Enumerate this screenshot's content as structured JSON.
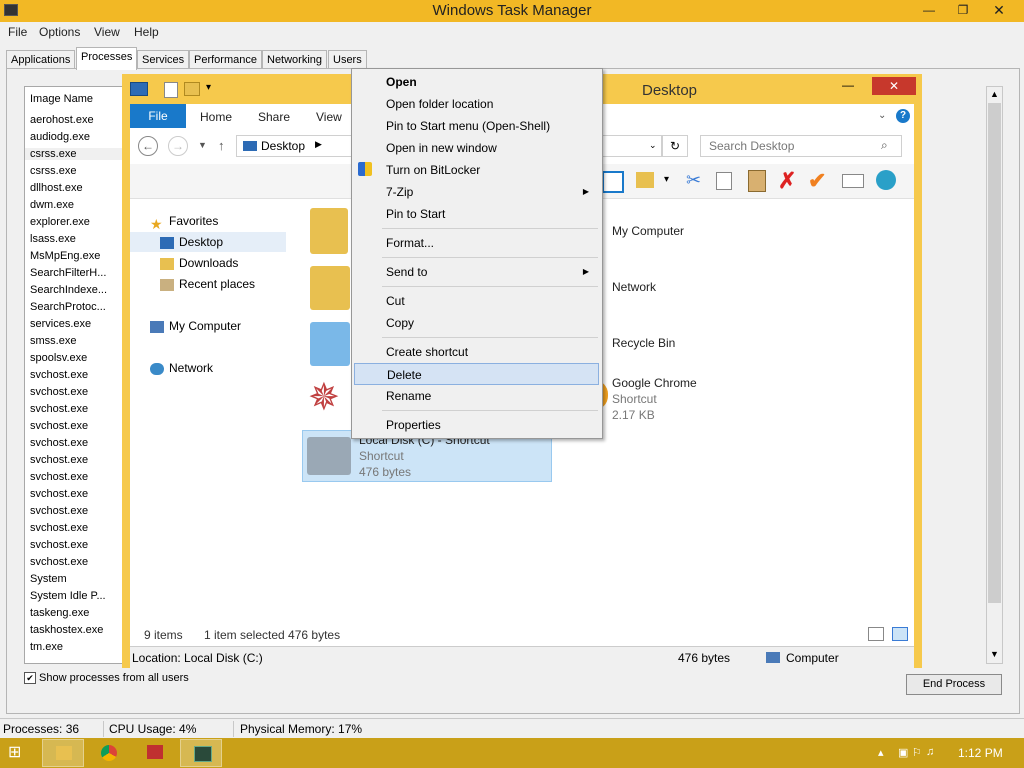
{
  "taskmgr": {
    "title": "Windows Task Manager",
    "menu": [
      "File",
      "Options",
      "View",
      "Help"
    ],
    "tabs": [
      "Applications",
      "Processes",
      "Services",
      "Performance",
      "Networking",
      "Users"
    ],
    "column_header": "Image Name",
    "processes": [
      "aerohost.exe",
      "audiodg.exe",
      "csrss.exe",
      "csrss.exe",
      "dllhost.exe",
      "dwm.exe",
      "explorer.exe",
      "lsass.exe",
      "MsMpEng.exe",
      "SearchFilterH...",
      "SearchIndexe...",
      "SearchProtoc...",
      "services.exe",
      "smss.exe",
      "spoolsv.exe",
      "svchost.exe",
      "svchost.exe",
      "svchost.exe",
      "svchost.exe",
      "svchost.exe",
      "svchost.exe",
      "svchost.exe",
      "svchost.exe",
      "svchost.exe",
      "svchost.exe",
      "svchost.exe",
      "svchost.exe",
      "System",
      "System Idle P...",
      "taskeng.exe",
      "taskhostex.exe",
      "tm.exe"
    ],
    "show_all_label": "Show processes from all users",
    "end_process_label": "End Process",
    "status": {
      "processes": "Processes: 36",
      "cpu": "CPU Usage: 4%",
      "memory": "Physical Memory: 17%"
    }
  },
  "explorer": {
    "title": "Desktop",
    "ribbon_tabs": [
      "File",
      "Home",
      "Share",
      "View"
    ],
    "address": "Desktop",
    "search_placeholder": "Search Desktop",
    "nav": {
      "favorites": "Favorites",
      "desktop": "Desktop",
      "downloads": "Downloads",
      "recent": "Recent places",
      "my_computer": "My Computer",
      "network": "Network"
    },
    "items_right": {
      "my_computer": "My Computer",
      "network": "Network",
      "recycle_bin": "Recycle Bin",
      "chrome": "Google Chrome",
      "chrome_type": "Shortcut",
      "chrome_size": "2.17 KB"
    },
    "selected_item": {
      "name": "Local Disk (C) - Shortcut",
      "type": "Shortcut",
      "size": "476 bytes"
    },
    "status": {
      "items": "9 items",
      "selected": "1 item selected  476 bytes"
    },
    "location_bar": {
      "location": "Location: Local Disk (C:)",
      "size": "476 bytes",
      "zone": "Computer"
    }
  },
  "context_menu": {
    "items": [
      {
        "label": "Open",
        "bold": true
      },
      {
        "label": "Open folder location"
      },
      {
        "label": "Pin to Start menu (Open-Shell)"
      },
      {
        "label": "Open in new window"
      },
      {
        "label": "Turn on BitLocker"
      },
      {
        "label": "7-Zip"
      },
      {
        "label": "Pin to Start"
      },
      {
        "label": "Format..."
      },
      {
        "label": "Send to"
      },
      {
        "label": "Cut"
      },
      {
        "label": "Copy"
      },
      {
        "label": "Create shortcut"
      },
      {
        "label": "Delete",
        "highlighted": true
      },
      {
        "label": "Rename"
      },
      {
        "label": "Properties"
      }
    ]
  },
  "taskbar": {
    "clock": "1:12 PM"
  },
  "colors": {
    "titlebar": "#f2b825",
    "taskbar": "#c9a018",
    "explorer_frame": "#f6c94c",
    "ribbon_file": "#1979ca",
    "menu_highlight": "#d5e3f4"
  }
}
